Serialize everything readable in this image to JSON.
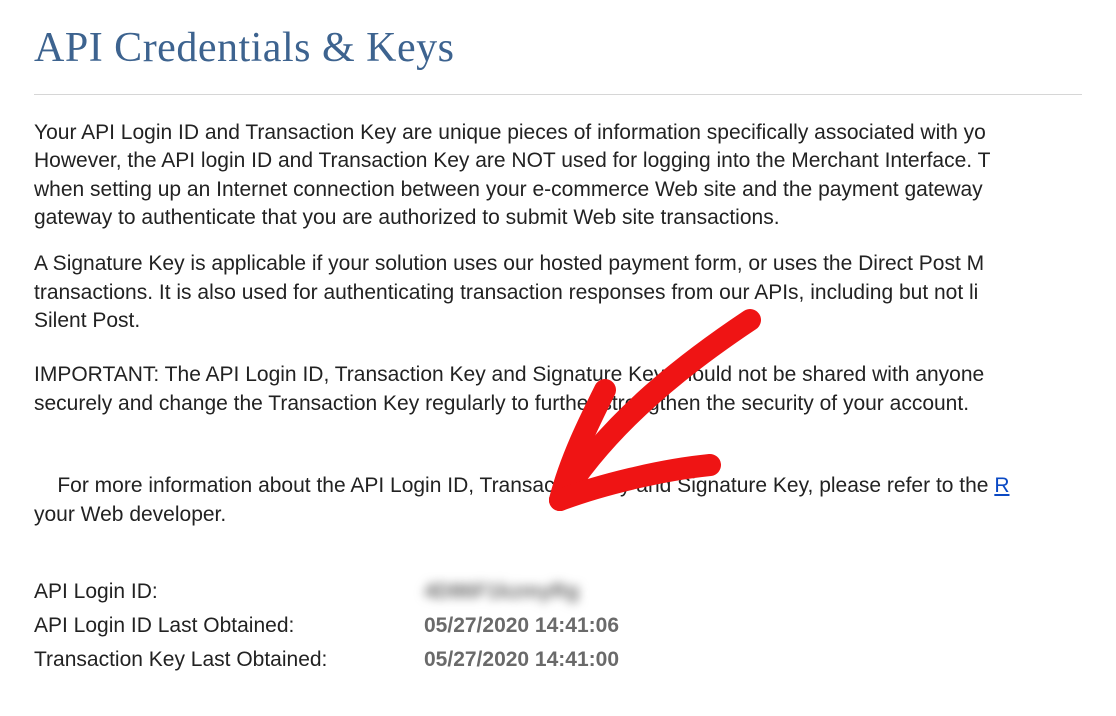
{
  "title": "API Credentials & Keys",
  "paragraphs": {
    "p1": "Your API Login ID and Transaction Key are unique pieces of information specifically associated with yo\nHowever, the API login ID and Transaction Key are NOT used for logging into the Merchant Interface. T\nwhen setting up an Internet connection between your e-commerce Web site and the payment gateway\ngateway to authenticate that you are authorized to submit Web site transactions.",
    "p2": "A Signature Key is applicable if your solution uses our hosted payment form, or uses the Direct Post M\ntransactions. It is also used for authenticating transaction responses from our APIs, including but not li\nSilent Post.",
    "p3": "IMPORTANT: The API Login ID, Transaction Key and Signature Key should not be shared with anyone\nsecurely and change the Transaction Key regularly to further strengthen the security of your account.",
    "p4_prefix": "For more information about the API Login ID, Transaction Key and Signature Key, please refer to the ",
    "p4_link": "R",
    "p4_suffix": "\nyour Web developer."
  },
  "fields": {
    "api_login_id": {
      "label": "API Login ID:",
      "value": "4D86F1kzmyRg"
    },
    "api_login_id_last_obtained": {
      "label": "API Login ID Last Obtained:",
      "value": "05/27/2020 14:41:06"
    },
    "transaction_key_last_obtained": {
      "label": "Transaction Key Last Obtained:",
      "value": "05/27/2020 14:41:00"
    }
  },
  "annotation": {
    "arrow_color": "#ef1414"
  }
}
